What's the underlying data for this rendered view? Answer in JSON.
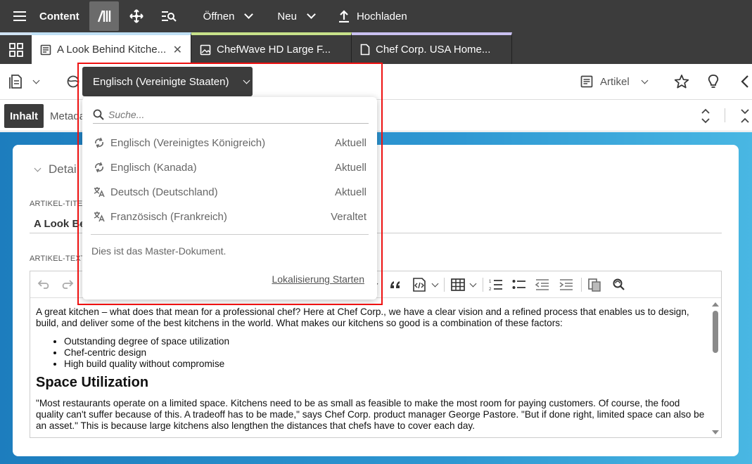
{
  "topbar": {
    "app_title": "Content",
    "open_label": "Öffnen",
    "new_label": "Neu",
    "upload_label": "Hochladen"
  },
  "tabs": [
    {
      "label": "A Look Behind Kitche...",
      "close": "✕"
    },
    {
      "label": "ChefWave HD Large F..."
    },
    {
      "label": "Chef Corp. USA Home..."
    }
  ],
  "toolbar": {
    "language_selected": "Englisch (Vereinigte Staaten)",
    "doc_type": "Artikel"
  },
  "subtabs": {
    "content": "Inhalt",
    "metadata": "Metada"
  },
  "form": {
    "section_title": "Detai",
    "title_label": "ARTIKEL-TITEL",
    "title_value": "A Look Be",
    "text_label": "ARTIKEL-TEXT"
  },
  "dropdown": {
    "search_placeholder": "Suche...",
    "items": [
      {
        "language": "Englisch (Vereinigtes Königreich)",
        "status": "Aktuell",
        "icon": "sync-icon"
      },
      {
        "language": "Englisch (Kanada)",
        "status": "Aktuell",
        "icon": "sync-icon"
      },
      {
        "language": "Deutsch (Deutschland)",
        "status": "Aktuell",
        "icon": "translate-icon"
      },
      {
        "language": "Französisch (Frankreich)",
        "status": "Veraltet",
        "icon": "translate-icon"
      }
    ],
    "master_note": "Dies ist das Master-Dokument.",
    "start_link": "Lokalisierung Starten"
  },
  "editor": {
    "paragraph1": "A great kitchen – what does that mean for a professional chef? Here at Chef Corp., we have a clear vision and a refined process that enables us to design, build, and deliver some of the best kitchens in the world. What makes our kitchens so good is a combination of these factors:",
    "bullets": [
      "Outstanding degree of space utilization",
      "Chef-centric design",
      "High build quality without compromise"
    ],
    "heading": "Space Utilization",
    "paragraph2": "\"Most restaurants operate on a limited space. Kitchens need to be as small as feasible to make the most room for paying customers. Of course, the food quality can't suffer because of this. A tradeoff has to be made,\" says Chef Corp. product manager George Pastore. \"But if done right, limited space can also be an asset.\" This is because large kitchens also lengthen the distances that chefs have to cover each day."
  },
  "colors": {
    "dark_bar": "#3c3c3c",
    "accent_blue": "#1d7dbe",
    "highlight_red": "#e11111"
  }
}
